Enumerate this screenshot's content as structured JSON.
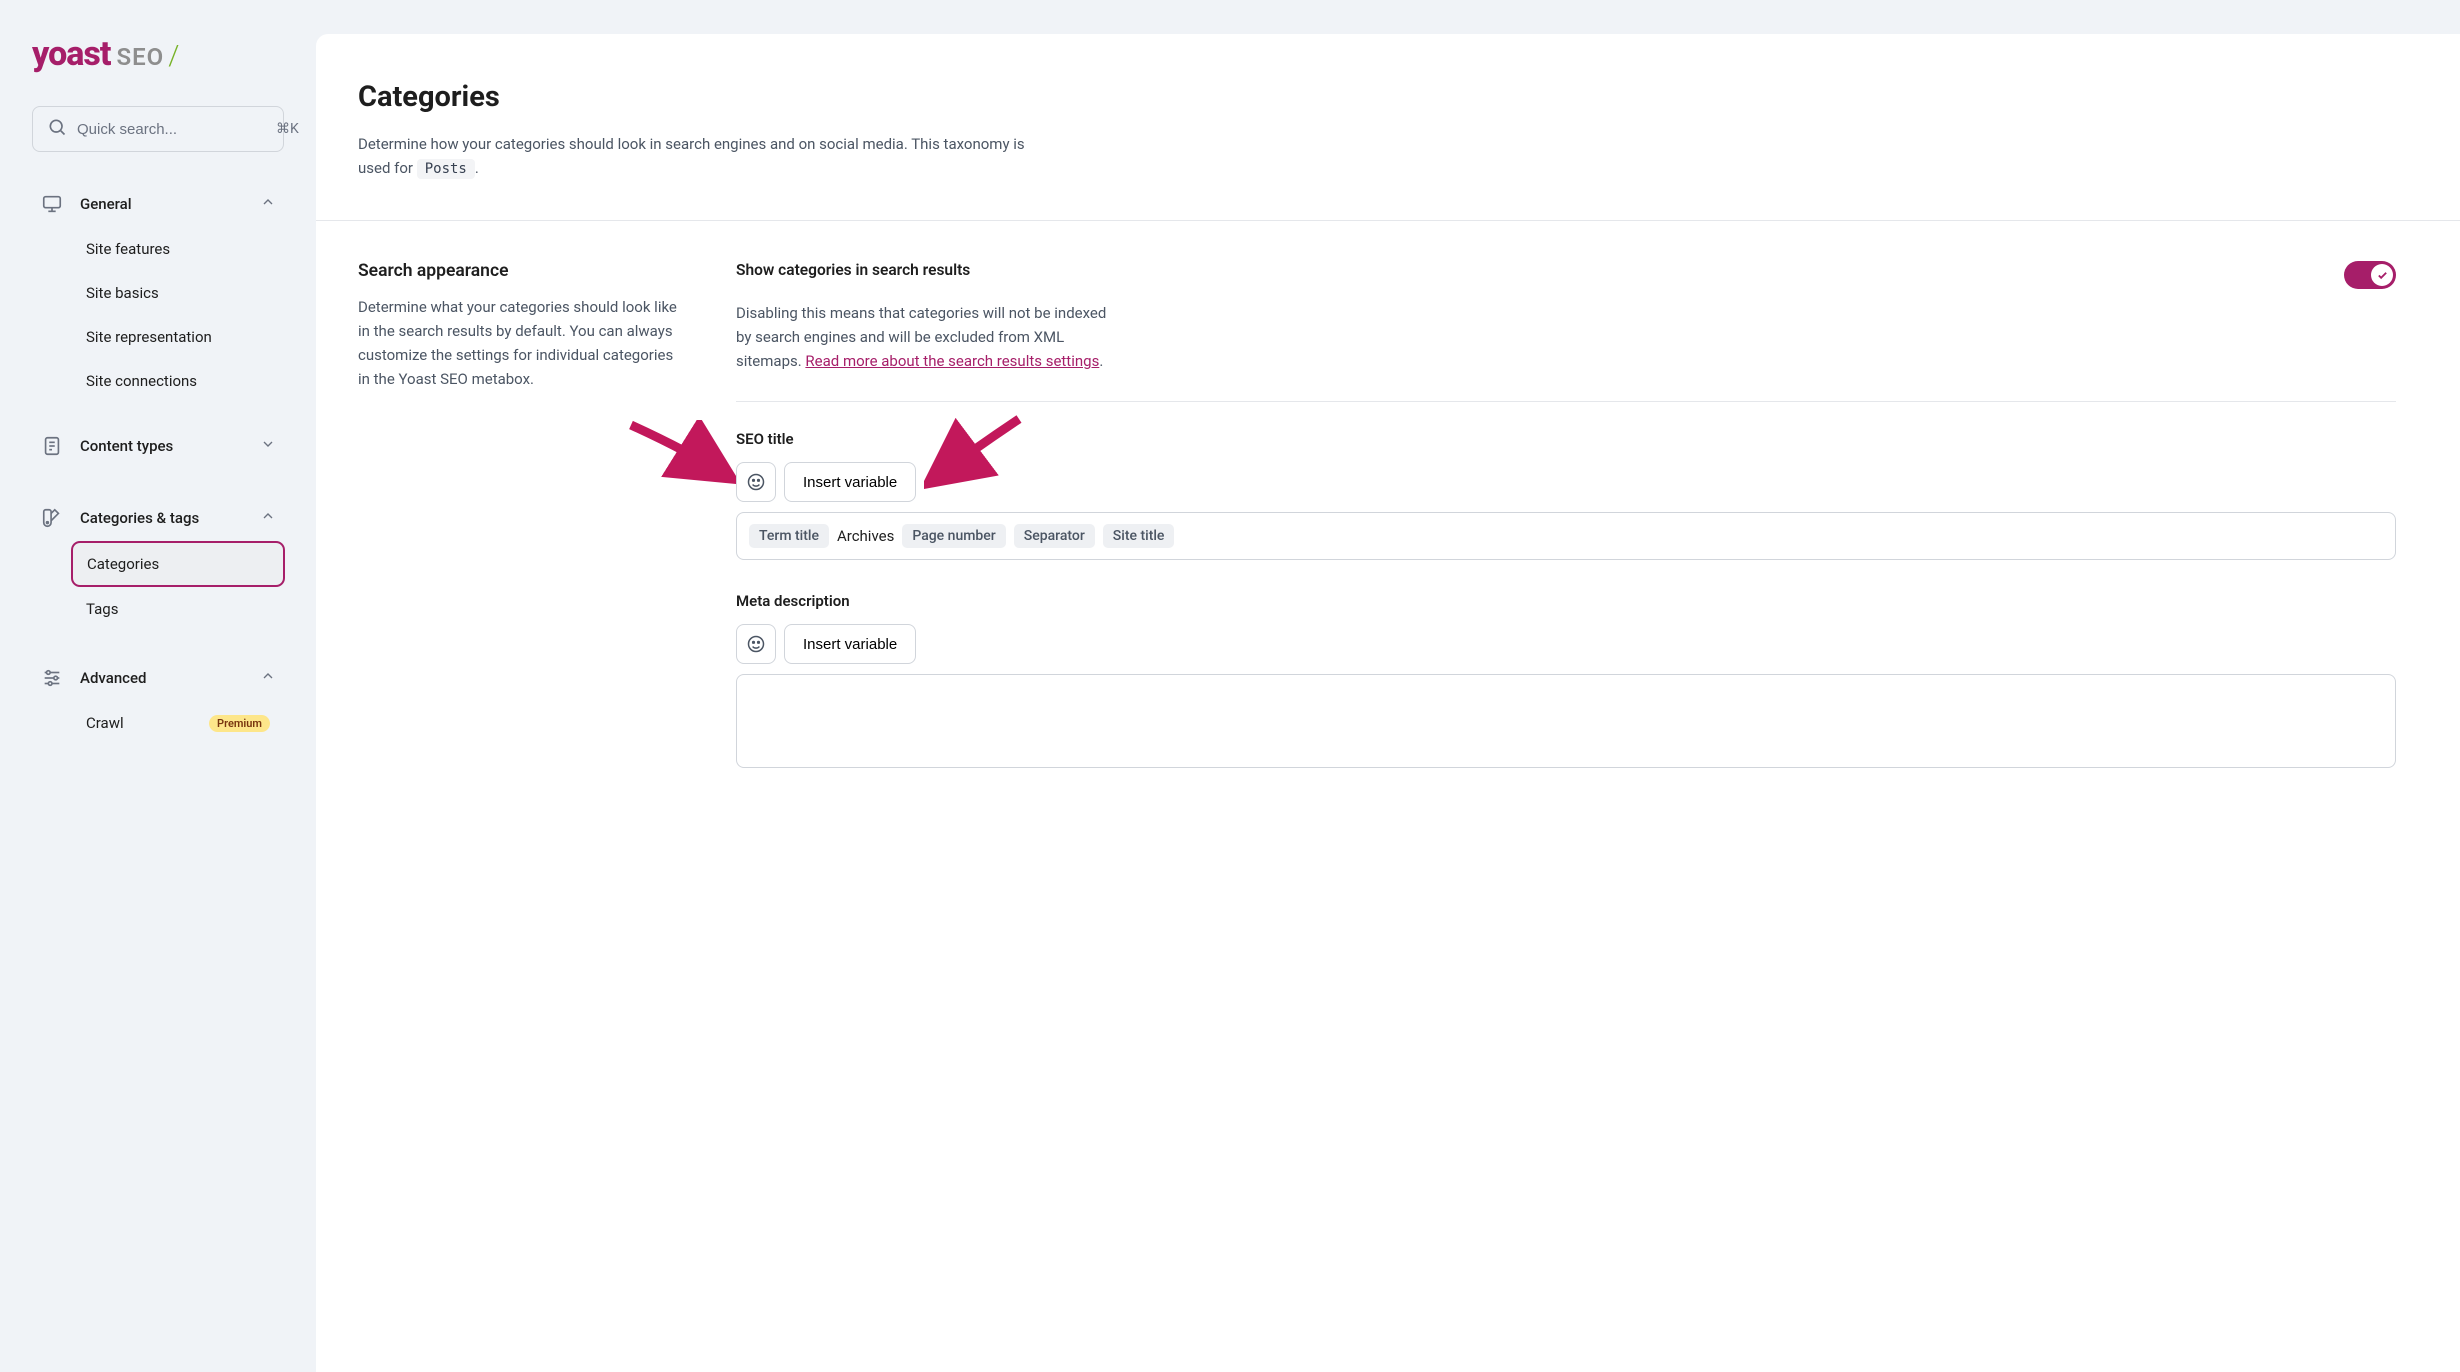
{
  "brand": {
    "name": "yoast",
    "product": "SEO",
    "slash": "/"
  },
  "search": {
    "placeholder": "Quick search...",
    "shortcut": "⌘K"
  },
  "nav": {
    "general": {
      "label": "General",
      "items": [
        "Site features",
        "Site basics",
        "Site representation",
        "Site connections"
      ]
    },
    "content_types": {
      "label": "Content types"
    },
    "categories_tags": {
      "label": "Categories & tags",
      "items": [
        "Categories",
        "Tags"
      ]
    },
    "advanced": {
      "label": "Advanced",
      "items": [
        {
          "label": "Crawl",
          "badge": "Premium"
        }
      ]
    }
  },
  "page": {
    "title": "Categories",
    "lead_pre": "Determine how your categories should look in search engines and on social media. This taxonomy is used for ",
    "lead_code": "Posts",
    "lead_post": "."
  },
  "appearance": {
    "heading": "Search appearance",
    "desc": "Determine what your categories should look like in the search results by default. You can always customize the settings for individual categories in the Yoast SEO metabox."
  },
  "toggle": {
    "label": "Show categories in search results",
    "desc_pre": "Disabling this means that categories will not be indexed by search engines and will be excluded from XML sitemaps. ",
    "link": "Read more about the search results settings",
    "desc_post": "."
  },
  "seo_title": {
    "label": "SEO title",
    "insert": "Insert variable",
    "chips": [
      "Term title",
      "Page number",
      "Separator",
      "Site title"
    ],
    "plain": "Archives"
  },
  "meta": {
    "label": "Meta description",
    "insert": "Insert variable"
  }
}
